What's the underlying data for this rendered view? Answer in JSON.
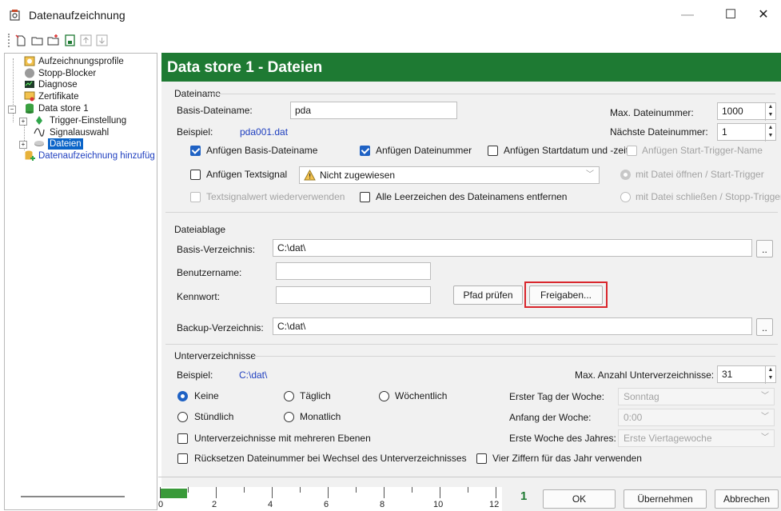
{
  "window": {
    "title": "Datenaufzeichnung",
    "minimize": "—",
    "maximize": "☐",
    "close": "✕"
  },
  "toolbar": {
    "icons": [
      "new-icon",
      "open-icon",
      "new-folder-icon",
      "save-icon",
      "move-up-icon",
      "move-down-icon"
    ]
  },
  "tree": {
    "items": [
      {
        "label": "Aufzeichnungsprofile"
      },
      {
        "label": "Stopp-Blocker"
      },
      {
        "label": "Diagnose"
      },
      {
        "label": "Zertifikate"
      },
      {
        "label": "Data store 1"
      },
      {
        "label": "Trigger-Einstellung"
      },
      {
        "label": "Signalauswahl"
      },
      {
        "label": "Dateien"
      },
      {
        "label": "Datenaufzeichnung hinzufüg"
      }
    ]
  },
  "header": {
    "title": "Data store 1 - Dateien",
    "color": "#1e7a33"
  },
  "dateiname": {
    "group_title": "Dateiname",
    "basis_label": "Basis-Dateiname:",
    "basis_value": "pda",
    "beispiel_label": "Beispiel:",
    "beispiel_value": "pda001.dat",
    "max_label": "Max. Dateinummer:",
    "max_value": "1000",
    "next_label": "Nächste Dateinummer:",
    "next_value": "1",
    "chk_basis": "Anfügen Basis-Dateiname",
    "chk_nummer": "Anfügen Dateinummer",
    "chk_startdatum": "Anfügen Startdatum und -zeit",
    "chk_trigger": "Anfügen Start-Trigger-Name",
    "chk_textsignal": "Anfügen Textsignal",
    "textsignal_value": "Nicht zugewiesen",
    "radio_open": "mit Datei öffnen / Start-Trigger",
    "chk_textsignalwert": "Textsignalwert wiederverwenden",
    "chk_leerzeichen": "Alle Leerzeichen des Dateinamens entfernen",
    "radio_close": "mit Datei schließen / Stopp-Trigger"
  },
  "dateiablage": {
    "group_title": "Dateiablage",
    "basis_dir_label": "Basis-Verzeichnis:",
    "basis_dir_value": "C:\\dat\\",
    "user_label": "Benutzername:",
    "user_value": "",
    "pw_label": "Kennwort:",
    "pw_value": "",
    "pfad_button": "Pfad prüfen",
    "freigaben_button": "Freigaben...",
    "backup_label": "Backup-Verzeichnis:",
    "backup_value": "C:\\dat\\",
    "browse": ".."
  },
  "unterverzeichnisse": {
    "group_title": "Unterverzeichnisse",
    "beispiel_label": "Beispiel:",
    "beispiel_value": "C:\\dat\\",
    "max_label": "Max. Anzahl Unterverzeichnisse:",
    "max_value": "31",
    "radio_keine": "Keine",
    "radio_taeglich": "Täglich",
    "radio_woechentlich": "Wöchentlich",
    "radio_stuendlich": "Stündlich",
    "radio_monatlich": "Monatlich",
    "erster_tag_label": "Erster Tag der Woche:",
    "erster_tag_value": "Sonntag",
    "anfang_label": "Anfang der Woche:",
    "anfang_value": "0:00",
    "erste_woche_label": "Erste Woche des Jahres:",
    "erste_woche_value": "Erste Viertagewoche",
    "chk_ebenen": "Unterverzeichnisse mit mehreren Ebenen",
    "chk_ruecksetzen": "Rücksetzen Dateinummer bei Wechsel des Unterverzeichnisses",
    "chk_vier": "Vier Ziffern für das Jahr verwenden"
  },
  "footer": {
    "ruler_labels": [
      "0",
      "2",
      "4",
      "6",
      "8",
      "10",
      "12"
    ],
    "count": "1",
    "ok": "OK",
    "apply": "Übernehmen",
    "cancel": "Abbrechen"
  }
}
